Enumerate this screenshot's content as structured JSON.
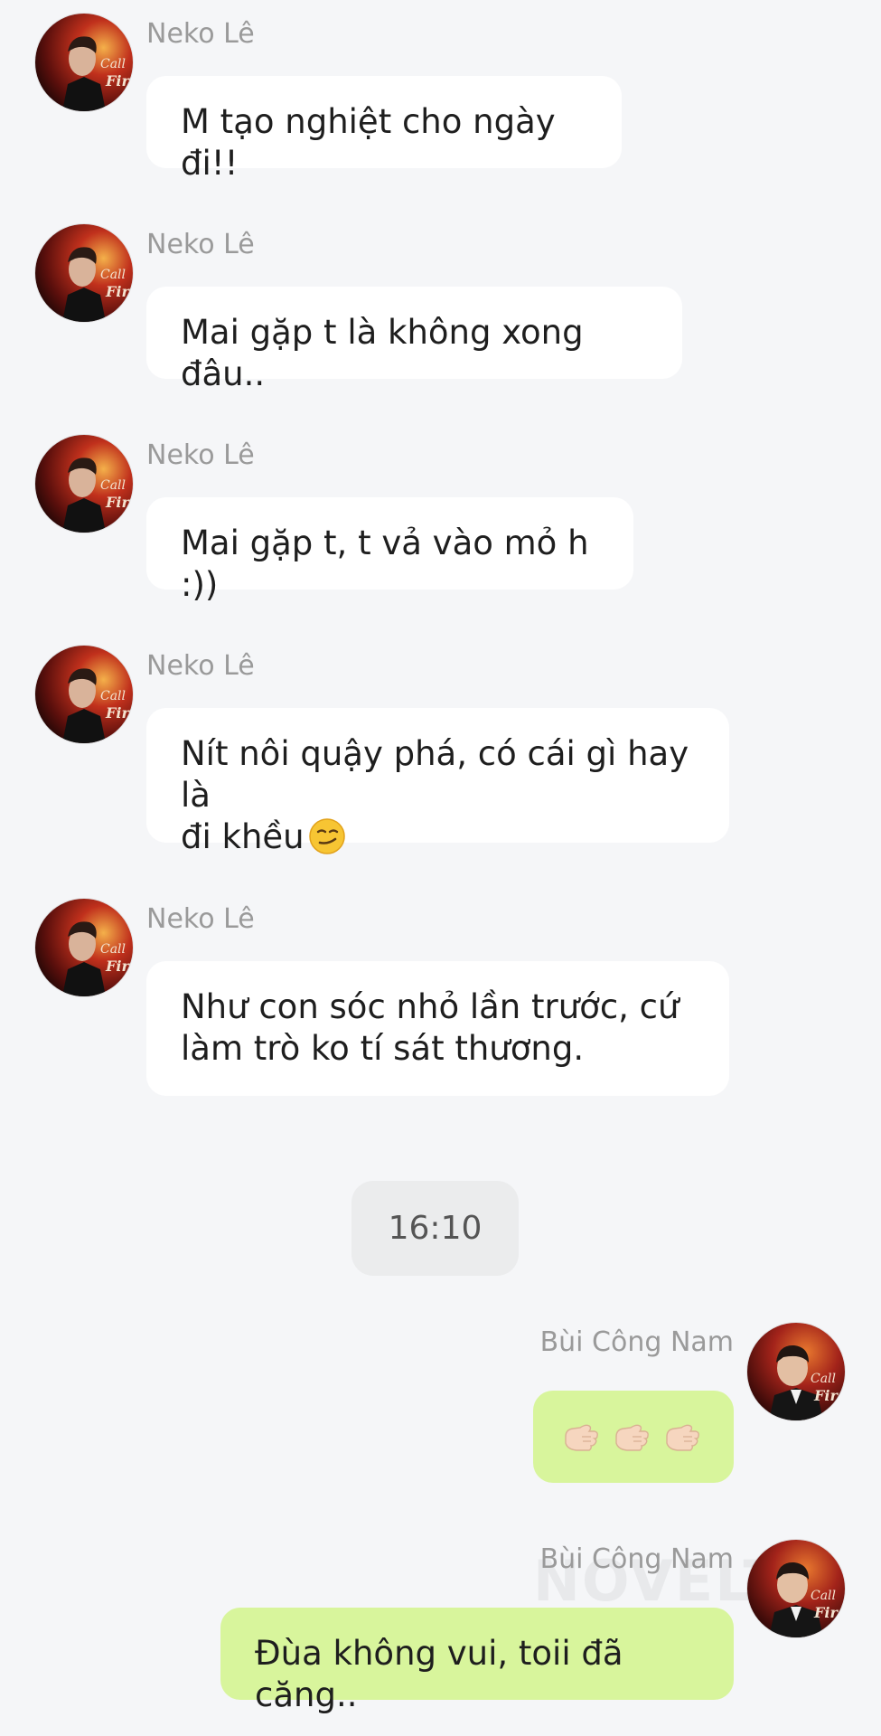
{
  "conversation": {
    "messages": [
      {
        "sender": "Neko Lê",
        "text": "M tạo nghiệt cho ngày đi!!"
      },
      {
        "sender": "Neko Lê",
        "text": "Mai gặp t là không xong đâu.."
      },
      {
        "sender": "Neko Lê",
        "text": "Mai gặp t, t vả vào mỏ h :))"
      },
      {
        "sender": "Neko Lê",
        "text": "Nít nôi quậy phá, có cái gì hay là\nđi khều",
        "emoji": "smirk-emoji"
      },
      {
        "sender": "Neko Lê",
        "text": "Như con sóc nhỏ lần trước, cứ\nlàm trò ko tí sát thương."
      }
    ],
    "time_separator": "16:10",
    "outgoing": [
      {
        "sender": "Bùi Công Nam",
        "content": [
          "thumbs-icon",
          "thumbs-icon",
          "thumbs-icon"
        ]
      },
      {
        "sender": "Bùi Công Nam",
        "text": "Đùa không vui, toii đã căng.."
      }
    ]
  },
  "watermark": "NOVELTC",
  "colors": {
    "background": "#f5f6f8",
    "incoming_bubble": "#ffffff",
    "outgoing_bubble": "#d8f59c",
    "sender_name": "#9a9a9a",
    "time_pill": "#ebeced"
  },
  "icons": {
    "incoming_avatar": "avatar-neko-le",
    "outgoing_avatar": "avatar-bui-cong-nam"
  }
}
